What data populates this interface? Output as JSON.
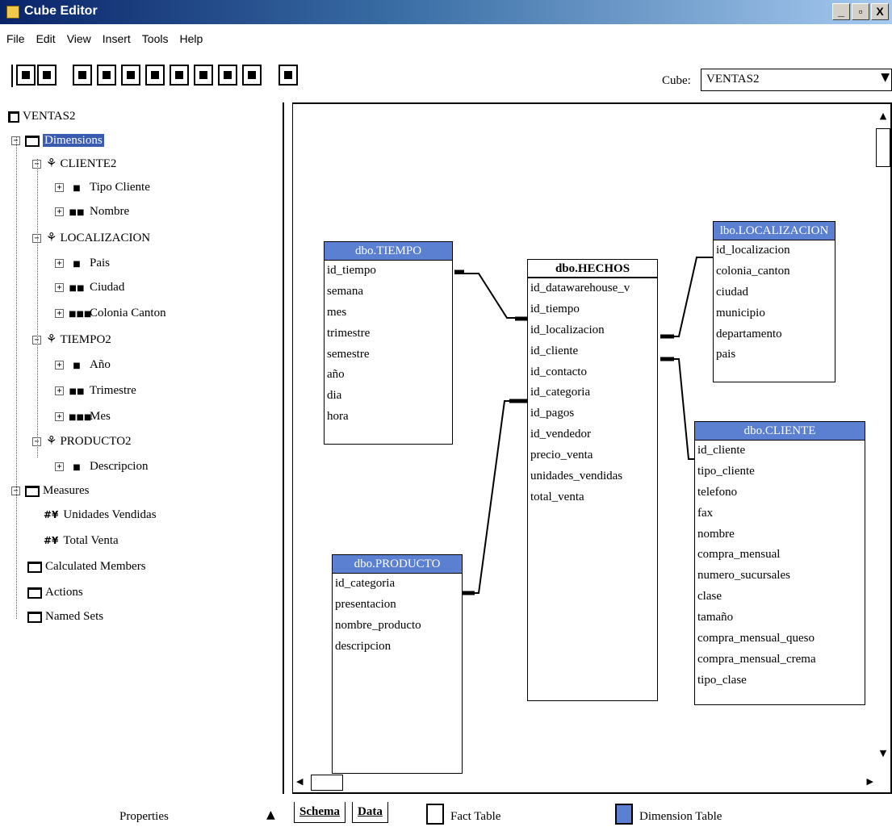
{
  "window": {
    "title": "Cube Editor",
    "buttons": [
      "_",
      "▫",
      "X"
    ]
  },
  "menu": [
    "File",
    "Edit",
    "View",
    "Insert",
    "Tools",
    "Help"
  ],
  "toolbar": {
    "cube_label": "Cube:",
    "cube_value": "VENTAS2",
    "dropdown_arrow": "▼"
  },
  "tree": {
    "root": "VENTAS2",
    "dimensions_label": "Dimensions",
    "dimensions": [
      {
        "name": "CLIENTE2",
        "levels": [
          "Tipo Cliente",
          "Nombre"
        ]
      },
      {
        "name": "LOCALIZACION",
        "levels": [
          "Pais",
          "Ciudad",
          "Colonia Canton"
        ]
      },
      {
        "name": "TIEMPO2",
        "levels": [
          "Año",
          "Trimestre",
          "Mes"
        ]
      },
      {
        "name": "PRODUCTO2",
        "levels": [
          "Descripcion"
        ]
      }
    ],
    "measures_label": "Measures",
    "measures": [
      "Unidades Vendidas",
      "Total Venta"
    ],
    "calculated_members": "Calculated Members",
    "actions": "Actions",
    "named_sets": "Named Sets"
  },
  "schema": {
    "tiempo": {
      "title": "dbo.TIEMPO",
      "fields": [
        "id_tiempo",
        "semana",
        "mes",
        "trimestre",
        "semestre",
        "año",
        "dia",
        "hora"
      ]
    },
    "hechos": {
      "title": "dbo.HECHOS",
      "fields": [
        "id_datawarehouse_v",
        "id_tiempo",
        "id_localizacion",
        "id_cliente",
        "id_contacto",
        "id_categoria",
        "id_pagos",
        "id_vendedor",
        "precio_venta",
        "unidades_vendidas",
        "total_venta"
      ]
    },
    "localizacion": {
      "title": "lbo.LOCALIZACION",
      "fields": [
        "id_localizacion",
        "colonia_canton",
        "ciudad",
        "municipio",
        "departamento",
        "pais"
      ]
    },
    "cliente": {
      "title": "dbo.CLIENTE",
      "fields": [
        "id_cliente",
        "tipo_cliente",
        "telefono",
        "fax",
        "nombre",
        "compra_mensual",
        "numero_sucursales",
        "clase",
        "tamaño",
        "compra_mensual_queso",
        "compra_mensual_crema",
        "tipo_clase"
      ]
    },
    "producto": {
      "title": "dbo.PRODUCTO",
      "fields": [
        "id_categoria",
        "presentacion",
        "nombre_producto",
        "descripcion"
      ]
    }
  },
  "status": {
    "properties_label": "Properties",
    "properties_arrow": "▲",
    "tabs": [
      "Schema",
      "Data"
    ],
    "legend": [
      {
        "label": "Fact Table",
        "color": "#ffffff"
      },
      {
        "label": "Dimension Table",
        "color": "#5b7fd1"
      }
    ]
  }
}
